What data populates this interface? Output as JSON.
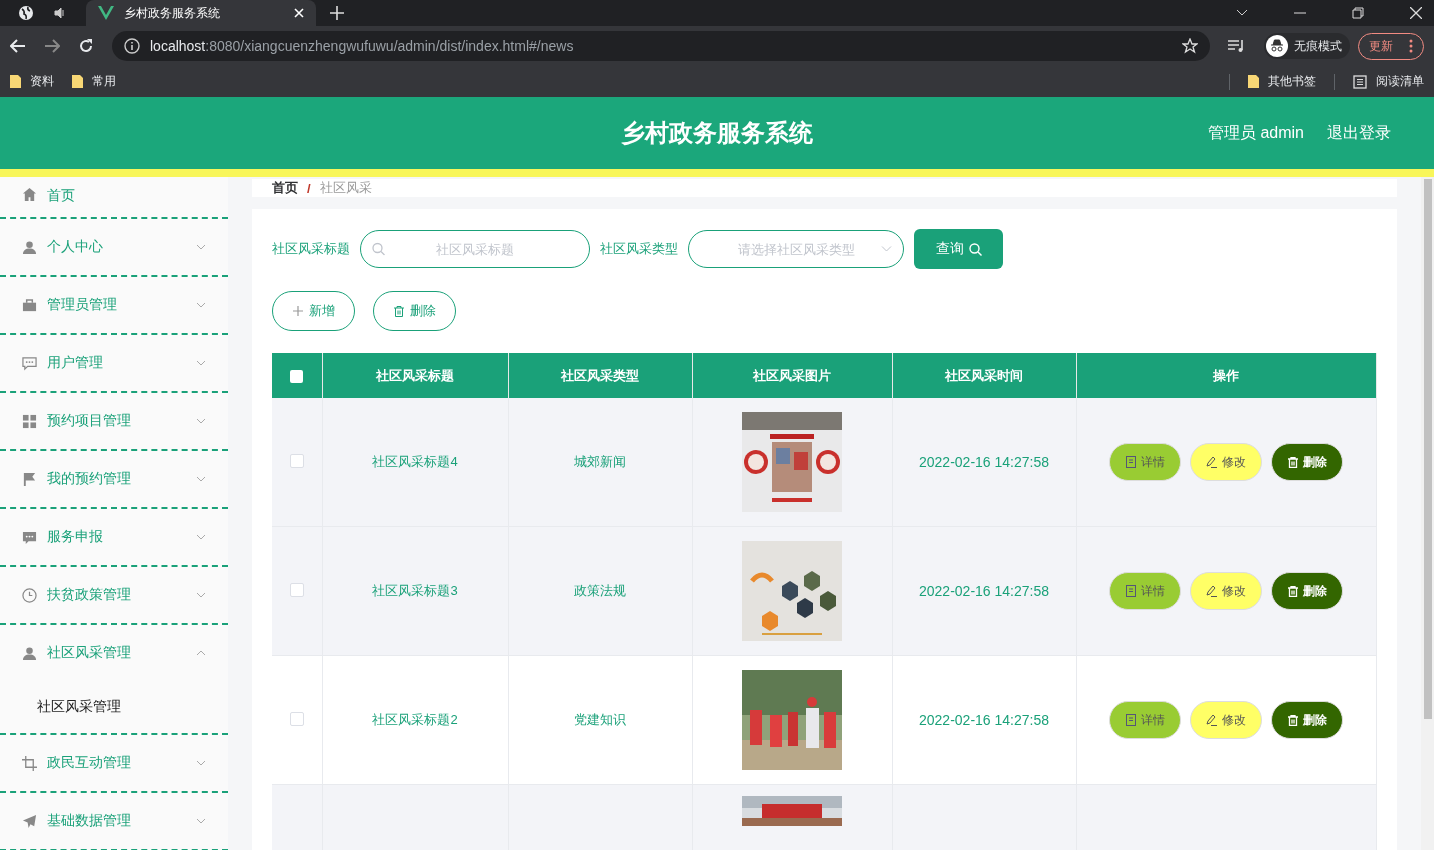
{
  "browser": {
    "tab_title": "乡村政务服务系统",
    "url_host": "localhost",
    "url_path": ":8080/xiangcuenzhengwufuwu/admin/dist/index.html#/news",
    "incognito_label": "无痕模式",
    "update_label": "更新",
    "bookmarks": [
      {
        "label": "资料",
        "kind": "folder"
      },
      {
        "label": "常用",
        "kind": "folder"
      }
    ],
    "bookmarks_right": [
      {
        "label": "其他书签",
        "kind": "folder"
      },
      {
        "label": "阅读清单",
        "kind": "list"
      }
    ]
  },
  "header": {
    "title": "乡村政务服务系统",
    "user": "管理员 admin",
    "logout": "退出登录"
  },
  "sidebar": {
    "items": [
      {
        "label": "首页",
        "kind": "link"
      },
      {
        "label": "个人中心",
        "kind": "submenu",
        "expanded": false
      },
      {
        "label": "管理员管理",
        "kind": "submenu",
        "expanded": false
      },
      {
        "label": "用户管理",
        "kind": "submenu",
        "expanded": false
      },
      {
        "label": "预约项目管理",
        "kind": "submenu",
        "expanded": false
      },
      {
        "label": "我的预约管理",
        "kind": "submenu",
        "expanded": false
      },
      {
        "label": "服务申报",
        "kind": "submenu",
        "expanded": false
      },
      {
        "label": "扶贫政策管理",
        "kind": "submenu",
        "expanded": false
      },
      {
        "label": "社区风采管理",
        "kind": "submenu",
        "expanded": true,
        "children": [
          {
            "label": "社区风采管理"
          }
        ]
      },
      {
        "label": "政民互动管理",
        "kind": "submenu",
        "expanded": false
      },
      {
        "label": "基础数据管理",
        "kind": "submenu",
        "expanded": false
      }
    ]
  },
  "breadcrumb": [
    {
      "label": "首页"
    },
    {
      "separator": "/",
      "label": "社区风采"
    }
  ],
  "search": {
    "title_label": "社区风采标题",
    "title_placeholder": "社区风采标题",
    "type_label": "社区风采类型",
    "type_placeholder": "请选择社区风采类型",
    "query_button": "查询"
  },
  "toolbar": [
    {
      "label": "新增",
      "kind": "add"
    },
    {
      "label": "删除",
      "kind": "delete"
    }
  ],
  "table": {
    "columns": [
      "社区风采标题",
      "社区风采类型",
      "社区风采图片",
      "社区风采时间",
      "操作"
    ],
    "header_checked": false,
    "rows": [
      {
        "title": "社区风采标题4",
        "type": "城郊新闻",
        "image": {
          "kind": "picture"
        },
        "time": "2022-02-16 14:27:58",
        "checked": false,
        "highlighted": true,
        "actions": [
          {
            "label": "详情",
            "kind": "detail"
          },
          {
            "label": "修改",
            "kind": "edit"
          },
          {
            "label": "删除",
            "kind": "delete"
          }
        ]
      },
      {
        "title": "社区风采标题3",
        "type": "政策法规",
        "image": {
          "kind": "picture"
        },
        "time": "2022-02-16 14:27:58",
        "checked": false,
        "highlighted": true,
        "actions": [
          {
            "label": "详情",
            "kind": "detail"
          },
          {
            "label": "修改",
            "kind": "edit"
          },
          {
            "label": "删除",
            "kind": "delete"
          }
        ]
      },
      {
        "title": "社区风采标题2",
        "type": "党建知识",
        "image": {
          "kind": "picture"
        },
        "time": "2022-02-16 14:27:58",
        "checked": false,
        "highlighted": false,
        "actions": [
          {
            "label": "详情",
            "kind": "detail"
          },
          {
            "label": "修改",
            "kind": "edit"
          },
          {
            "label": "删除",
            "kind": "delete"
          }
        ]
      },
      {
        "image": {
          "kind": "picture"
        },
        "highlighted": true
      }
    ]
  }
}
